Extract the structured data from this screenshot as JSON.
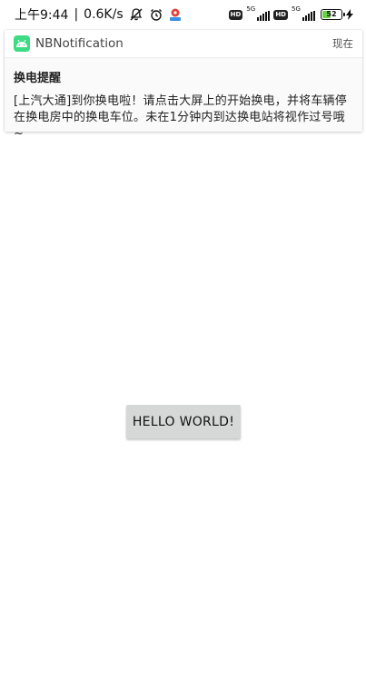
{
  "statusbar": {
    "time": "上午9:44",
    "separator": "|",
    "net_speed": "0.6K/s",
    "left_icons": [
      "mute-icon",
      "alarm-icon",
      "app-notification-icon"
    ],
    "hd_label": "HD",
    "network_label": "5G",
    "battery_percent": "52"
  },
  "notification": {
    "app_name": "NBNotification",
    "time": "现在",
    "title": "换电提醒",
    "text": "[上汽大通]到你换电啦！请点击大屏上的开始换电，并将车辆停在换电房中的换电车位。未在1分钟内到达换电站将视作过号哦~"
  },
  "main": {
    "button_label": "HELLO WORLD!"
  },
  "colors": {
    "app_icon": "#3ddc84",
    "battery_fill": "#6bd04a",
    "button_bg": "#d6d7d7"
  }
}
